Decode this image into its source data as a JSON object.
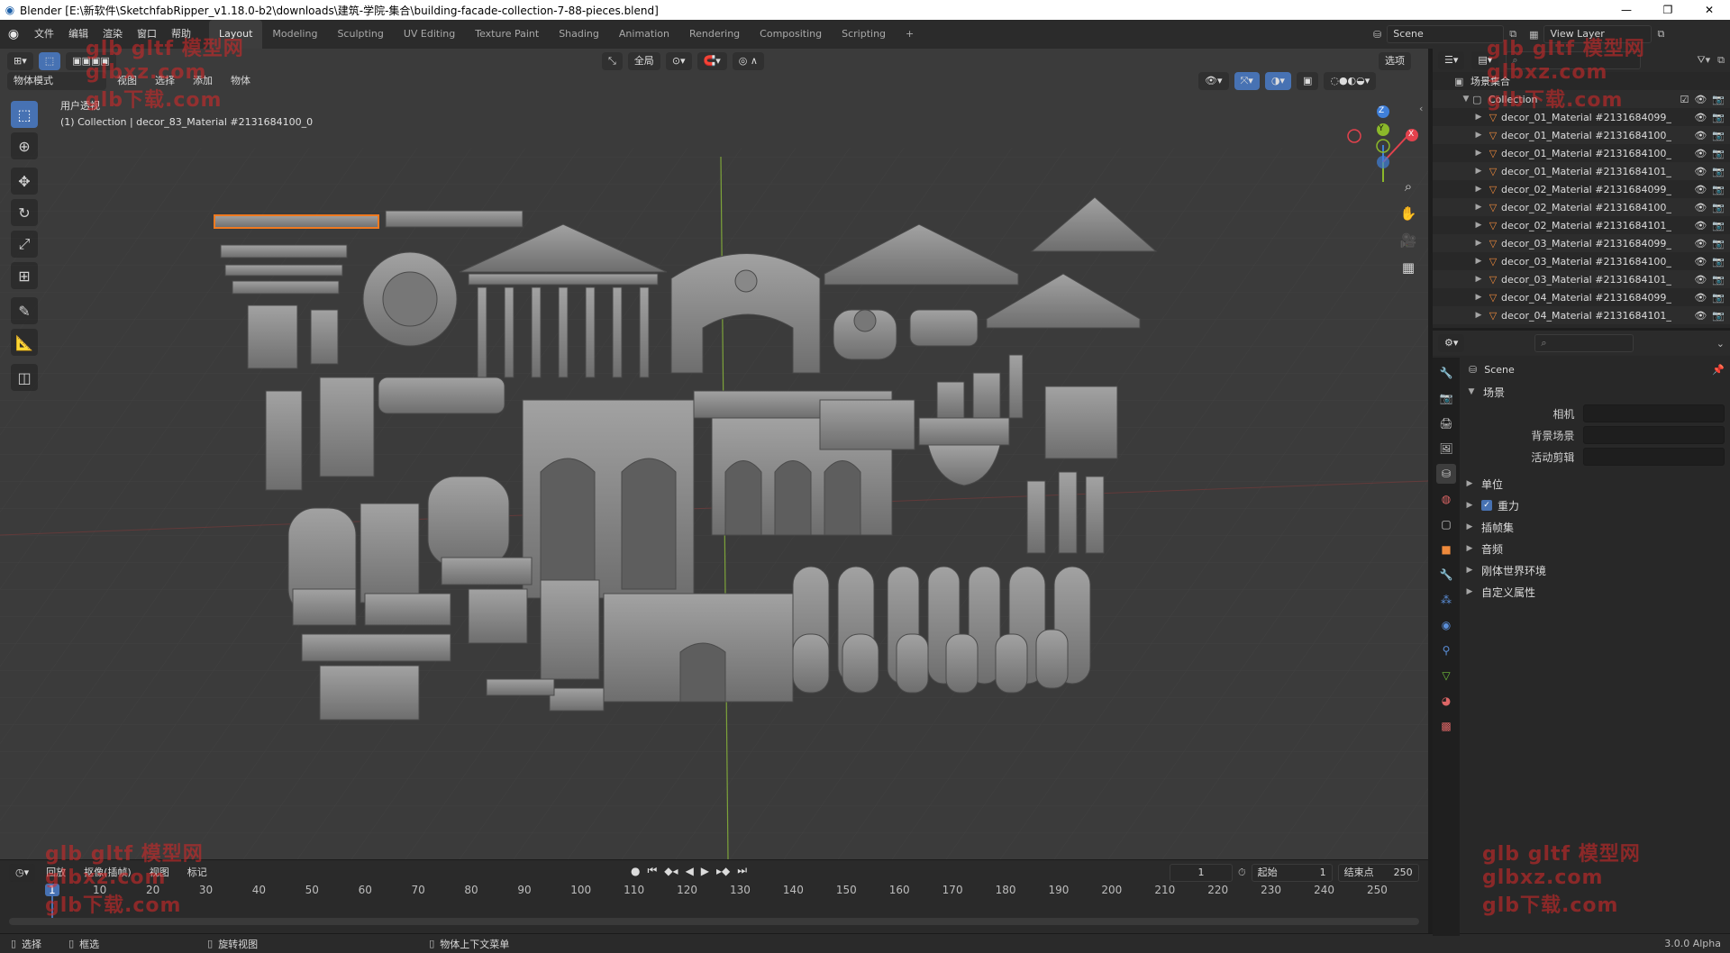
{
  "window": {
    "title": "Blender [E:\\新软件\\SketchfabRipper_v1.18.0-b2\\downloads\\建筑-学院-集合\\building-facade-collection-7-88-pieces.blend]",
    "minimize": "—",
    "maximize": "❐",
    "close": "✕"
  },
  "menu": [
    "文件",
    "编辑",
    "渲染",
    "窗口",
    "帮助"
  ],
  "workspaces": [
    "Layout",
    "Modeling",
    "Sculpting",
    "UV Editing",
    "Texture Paint",
    "Shading",
    "Animation",
    "Rendering",
    "Compositing",
    "Scripting"
  ],
  "add_workspace": "+",
  "scene": {
    "name": "Scene",
    "view_layer": "View Layer"
  },
  "viewport_header": {
    "mode": "物体模式",
    "menus": [
      "视图",
      "选择",
      "添加",
      "物体"
    ],
    "transform_orientation": "全局",
    "options": "选项"
  },
  "viewport": {
    "view_name": "用户透视",
    "active_info": "(1) Collection | decor_83_Material #2131684100_0",
    "gizmo": {
      "x": "X",
      "y": "Y",
      "z": "Z"
    }
  },
  "outliner": {
    "root": "场景集合",
    "collection": "Collection",
    "items": [
      "decor_01_Material #2131684099_",
      "decor_01_Material #2131684100_",
      "decor_01_Material #2131684100_",
      "decor_01_Material #2131684101_",
      "decor_02_Material #2131684099_",
      "decor_02_Material #2131684100_",
      "decor_02_Material #2131684101_",
      "decor_03_Material #2131684099_",
      "decor_03_Material #2131684100_",
      "decor_03_Material #2131684101_",
      "decor_04_Material #2131684099_",
      "decor_04_Material #2131684101_"
    ]
  },
  "properties": {
    "context": "Scene",
    "section": "场景",
    "fields": [
      {
        "label": "相机",
        "value": ""
      },
      {
        "label": "背景场景",
        "value": ""
      },
      {
        "label": "活动剪辑",
        "value": ""
      }
    ],
    "panels": [
      "单位",
      "重力",
      "插帧集",
      "音频",
      "刚体世界环境",
      "自定义属性"
    ],
    "gravity_checked": true
  },
  "timeline": {
    "menus": [
      "回放",
      "抠像(插帧)",
      "视图",
      "标记"
    ],
    "current_frame": "1",
    "start_label": "起始",
    "start": "1",
    "end_label": "结束点",
    "end": "250",
    "ticks": [
      "1",
      "10",
      "20",
      "30",
      "40",
      "50",
      "60",
      "70",
      "80",
      "90",
      "100",
      "110",
      "120",
      "130",
      "140",
      "150",
      "160",
      "170",
      "180",
      "190",
      "200",
      "210",
      "220",
      "230",
      "240",
      "250"
    ]
  },
  "statusbar": {
    "select": "选择",
    "box_select": "框选",
    "rotate_view": "旋转视图",
    "context_menu": "物体上下文菜单",
    "version": "3.0.0 Alpha"
  },
  "watermark": [
    "glb gltf 模型网",
    "glbxz.com",
    "glb下载.com"
  ],
  "colors": {
    "accent": "#4772b3",
    "object_orange": "#ef8a3c",
    "selection_outline": "#f07a20",
    "x_axis": "#e3424d",
    "y_axis": "#8bb82a",
    "z_axis": "#3f7fd9"
  }
}
